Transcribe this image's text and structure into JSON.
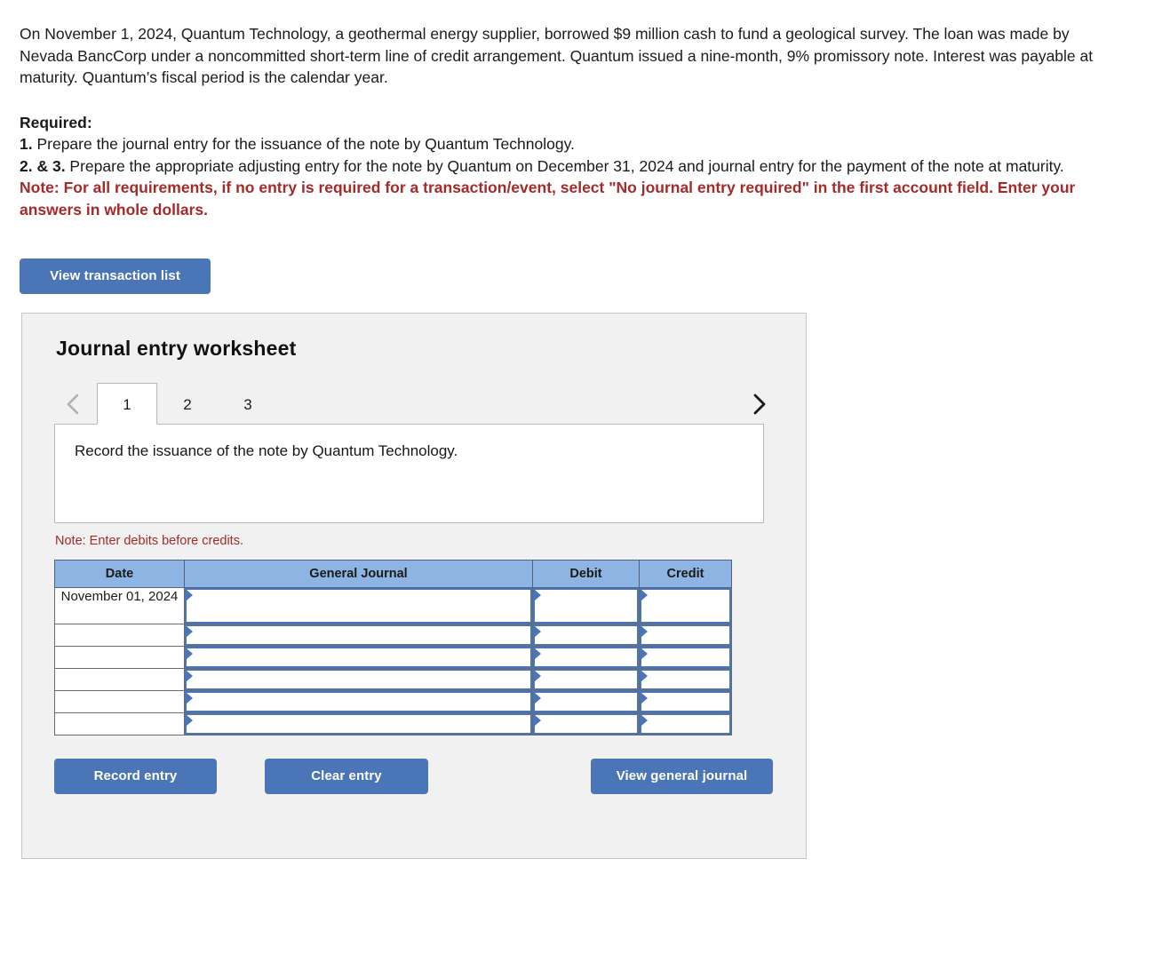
{
  "problem": {
    "paragraph": "On November 1, 2024, Quantum Technology, a geothermal energy supplier, borrowed $9 million cash to fund a geological survey. The loan was made by Nevada BancCorp under a noncommitted short-term line of credit arrangement. Quantum issued a nine-month, 9% promissory note. Interest was payable at maturity. Quantum’s fiscal period is the calendar year."
  },
  "required": {
    "heading": "Required:",
    "item1_number": "1.",
    "item1_text": " Prepare the journal entry for the issuance of the note by Quantum Technology.",
    "item2_number": "2. & 3.",
    "item2_text": " Prepare the appropriate adjusting entry for the note by Quantum on December 31, 2024 and journal entry for the payment of the note at maturity.",
    "red_note": "Note: For all requirements, if no entry is required for a transaction/event, select \"No journal entry required\" in the first account field. Enter your answers in whole dollars."
  },
  "toolbar": {
    "view_transaction_list_label": "View transaction list"
  },
  "worksheet": {
    "title": "Journal entry worksheet",
    "prev_icon": "chevron-left-icon",
    "next_icon": "chevron-right-icon",
    "tabs": [
      {
        "label": "1",
        "active": true
      },
      {
        "label": "2",
        "active": false
      },
      {
        "label": "3",
        "active": false
      }
    ],
    "instruction": "Record the issuance of the note by Quantum Technology.",
    "note_debits": "Note: Enter debits before credits.",
    "table": {
      "columns": [
        "Date",
        "General Journal",
        "Debit",
        "Credit"
      ],
      "rows": [
        {
          "date": "November 01, 2024",
          "general_journal": "",
          "debit": "",
          "credit": ""
        },
        {
          "date": "",
          "general_journal": "",
          "debit": "",
          "credit": ""
        },
        {
          "date": "",
          "general_journal": "",
          "debit": "",
          "credit": ""
        },
        {
          "date": "",
          "general_journal": "",
          "debit": "",
          "credit": ""
        },
        {
          "date": "",
          "general_journal": "",
          "debit": "",
          "credit": ""
        },
        {
          "date": "",
          "general_journal": "",
          "debit": "",
          "credit": ""
        }
      ]
    },
    "buttons": {
      "record_entry": "Record entry",
      "clear_entry": "Clear entry",
      "view_general_journal": "View general journal"
    }
  },
  "colors": {
    "button_blue": "#4a76b8",
    "header_blue": "#8db4e2",
    "note_red": "#a52a2a",
    "panel_bg": "#f1f1f1"
  }
}
